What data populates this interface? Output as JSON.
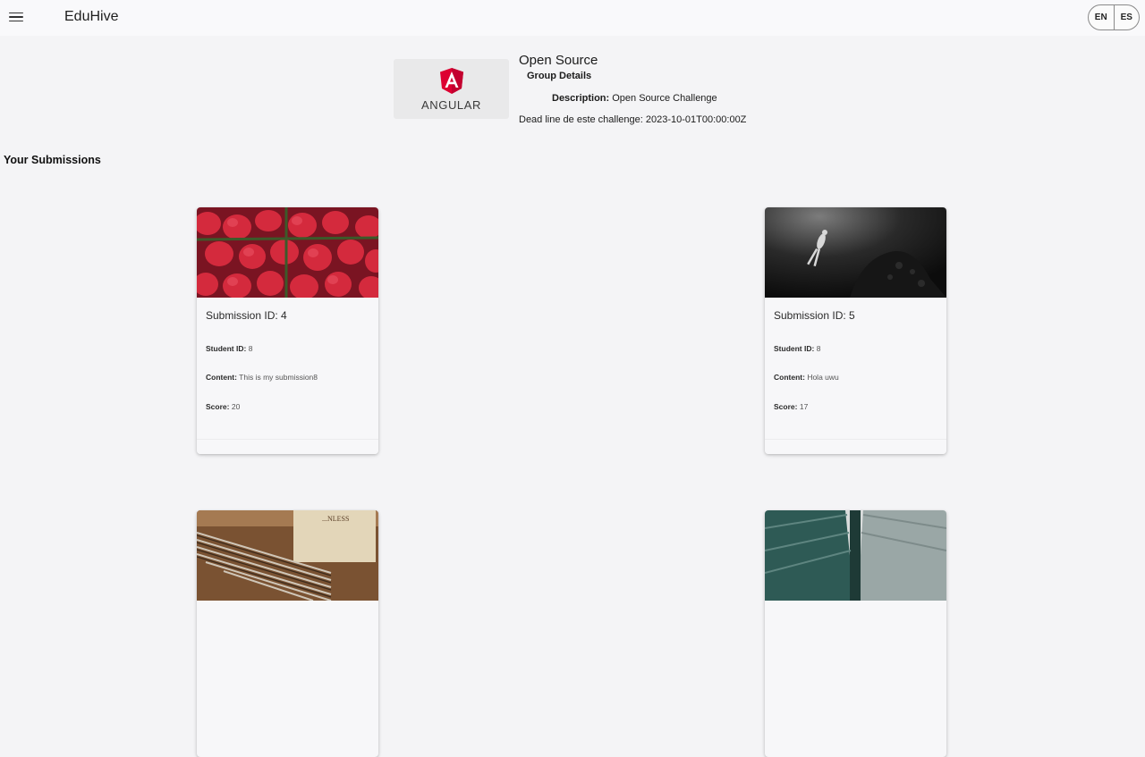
{
  "header": {
    "app_title": "EduHive",
    "menu_icon": "hamburger-menu-icon",
    "languages": [
      "EN",
      "ES"
    ]
  },
  "group": {
    "logo_text": "ANGULAR",
    "title": "Open Source",
    "subtitle": "Group Details",
    "description_label": "Description:",
    "description": "Open Source Challenge",
    "deadline": "Dead line de este challenge: 2023-10-01T00:00:00Z"
  },
  "submissions_section": {
    "title": "Your Submissions",
    "student_label": "Student ID:",
    "content_label": "Content:",
    "score_label": "Score:",
    "cards": [
      {
        "title": "Submission ID: 4",
        "student_id": "8",
        "content": "This is my submission8",
        "score": "20",
        "image": "strawberries-photo"
      },
      {
        "title": "Submission ID: 5",
        "student_id": "8",
        "content": "Hola uwu",
        "score": "17",
        "image": "scuba-diver-photo"
      },
      {
        "title": "",
        "student_id": "",
        "content": "",
        "score": "",
        "image": "brushes-photo"
      },
      {
        "title": "",
        "student_id": "",
        "content": "",
        "score": "",
        "image": "bridge-underside-photo"
      }
    ]
  },
  "colors": {
    "background": "#f4f4f6",
    "topbar": "#f9f9fb",
    "angular_red": "#dd0031"
  }
}
